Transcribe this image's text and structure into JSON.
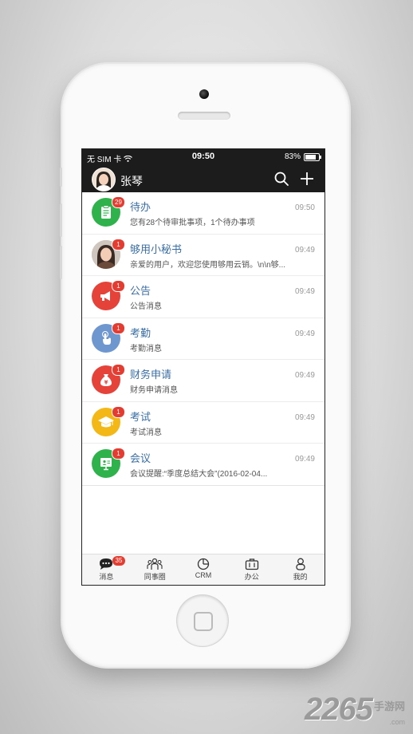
{
  "status_bar": {
    "carrier": "无 SIM 卡",
    "time": "09:50",
    "battery": "83%",
    "battery_level": 0.83
  },
  "header": {
    "user_name": "张琴",
    "search_icon": "search-icon",
    "add_icon": "plus-icon"
  },
  "messages": [
    {
      "title": "待办",
      "subtitle": "您有28个待审批事项，1个待办事项",
      "time": "09:50",
      "badge": "29",
      "icon": "clipboard-icon",
      "color": "#2fb24c"
    },
    {
      "title": "够用小秘书",
      "subtitle": "亲爱的用户，欢迎您使用够用云销。\\n\\n够...",
      "time": "09:49",
      "badge": "1",
      "icon": "avatar-photo",
      "color": "#d9a88a"
    },
    {
      "title": "公告",
      "subtitle": "公告消息",
      "time": "09:49",
      "badge": "1",
      "icon": "megaphone-icon",
      "color": "#e5423a"
    },
    {
      "title": "考勤",
      "subtitle": "考勤消息",
      "time": "09:49",
      "badge": "1",
      "icon": "hand-tap-icon",
      "color": "#6f97cf"
    },
    {
      "title": "财务申请",
      "subtitle": "财务申请消息",
      "time": "09:49",
      "badge": "1",
      "icon": "money-bag-icon",
      "color": "#e5423a"
    },
    {
      "title": "考试",
      "subtitle": "考试消息",
      "time": "09:49",
      "badge": "1",
      "icon": "graduation-cap-icon",
      "color": "#f3b816"
    },
    {
      "title": "会议",
      "subtitle": "会议提醒:“季度总结大会”(2016-02-04...",
      "time": "09:49",
      "badge": "1",
      "icon": "presentation-board-icon",
      "color": "#2fb24c"
    }
  ],
  "tabbar": [
    {
      "label": "消息",
      "icon": "chat-bubble-icon",
      "badge": "35",
      "active": true
    },
    {
      "label": "同事圈",
      "icon": "people-group-icon"
    },
    {
      "label": "CRM",
      "icon": "pie-chart-icon"
    },
    {
      "label": "办公",
      "icon": "briefcase-icon"
    },
    {
      "label": "我的",
      "icon": "person-icon"
    }
  ],
  "watermark": {
    "digits": "2265",
    "text": "手游网",
    "domain": ".com"
  }
}
